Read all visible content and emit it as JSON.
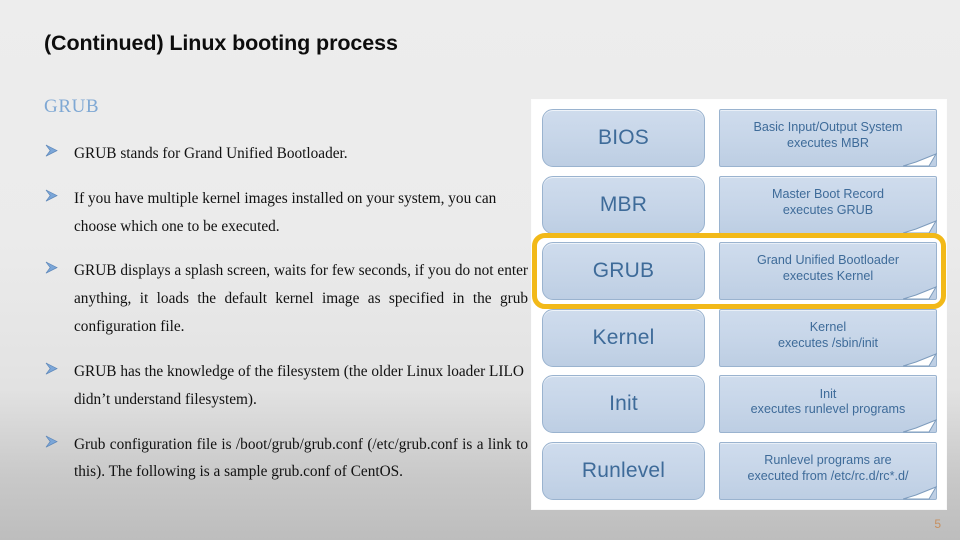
{
  "slide": {
    "title": "(Continued) Linux booting process",
    "page_number": "5",
    "page_number_color": "#c8874f",
    "background_color": "#ebebeb"
  },
  "content": {
    "section_heading": "GRUB",
    "section_heading_color": "#7fa8d4",
    "bullet_icon": "arrowhead-bullet-icon",
    "bullets": [
      "GRUB stands for Grand Unified Bootloader.",
      "If you have multiple kernel images installed on your system, you can choose which one to be executed.",
      "GRUB displays a splash screen, waits for few seconds, if you do not enter anything, it loads the default kernel image as specified in the grub configuration file.",
      "GRUB has the knowledge of the filesystem (the older Linux loader LILO didn’t understand filesystem).",
      "Grub configuration file is /boot/grub/grub.conf (/etc/grub.conf is a link to this). The following is a sample grub.conf of CentOS."
    ]
  },
  "diagram": {
    "panel_background": "#ffffff",
    "box_fill_color": "#c6d5e8",
    "box_border_color": "#9ab3cf",
    "box_text_color": "#3e6b99",
    "highlight_color": "#f2b919",
    "highlighted_stage": "GRUB",
    "rows": [
      {
        "stage": "BIOS",
        "note_line1": "Basic Input/Output System",
        "note_line2": "executes MBR",
        "highlighted": false
      },
      {
        "stage": "MBR",
        "note_line1": "Master Boot Record",
        "note_line2": "executes GRUB",
        "highlighted": false
      },
      {
        "stage": "GRUB",
        "note_line1": "Grand Unified Bootloader",
        "note_line2": "executes Kernel",
        "highlighted": true
      },
      {
        "stage": "Kernel",
        "note_line1": "Kernel",
        "note_line2": "executes /sbin/init",
        "highlighted": false
      },
      {
        "stage": "Init",
        "note_line1": "Init",
        "note_line2": "executes runlevel programs",
        "highlighted": false
      },
      {
        "stage": "Runlevel",
        "note_line1": "Runlevel programs are",
        "note_line2": "executed from /etc/rc.d/rc*.d/",
        "highlighted": false
      }
    ]
  }
}
